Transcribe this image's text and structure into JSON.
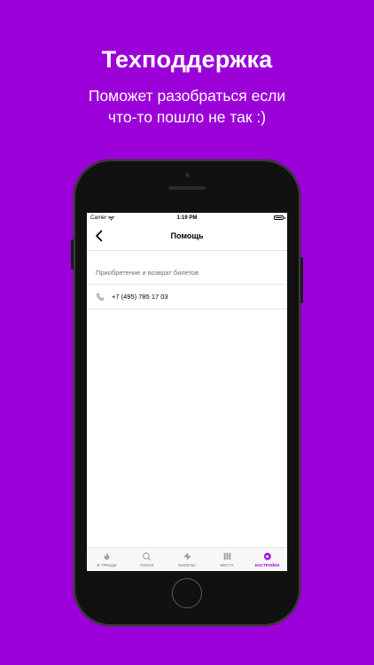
{
  "promo": {
    "headline": "Техподдержка",
    "subline_1": "Поможет разобраться если",
    "subline_2": "что-то пошло не так :)"
  },
  "statusbar": {
    "carrier": "Carrier",
    "time": "1:19 PM"
  },
  "navbar": {
    "title": "Помощь",
    "back_icon": "chevron-left-icon"
  },
  "help": {
    "section_title": "Приобретение и возврат билетов",
    "phone_number": "+7 (495) 785 17 03",
    "phone_icon": "phone-icon"
  },
  "tabbar": {
    "active": "settings",
    "items": [
      {
        "label": "В ТРЕНДЕ",
        "icon": "flame-icon"
      },
      {
        "label": "ПОИСК",
        "icon": "search-icon"
      },
      {
        "label": "БИЛЕТЫ",
        "icon": "ticket-icon"
      },
      {
        "label": "МЕСТА",
        "icon": "places-icon"
      },
      {
        "label": "НАСТРОЙКИ",
        "icon": "gear-icon"
      }
    ]
  },
  "colors": {
    "background": "#9C00D9",
    "accent": "#9C00D9",
    "tab_inactive": "#9a9a9a"
  }
}
